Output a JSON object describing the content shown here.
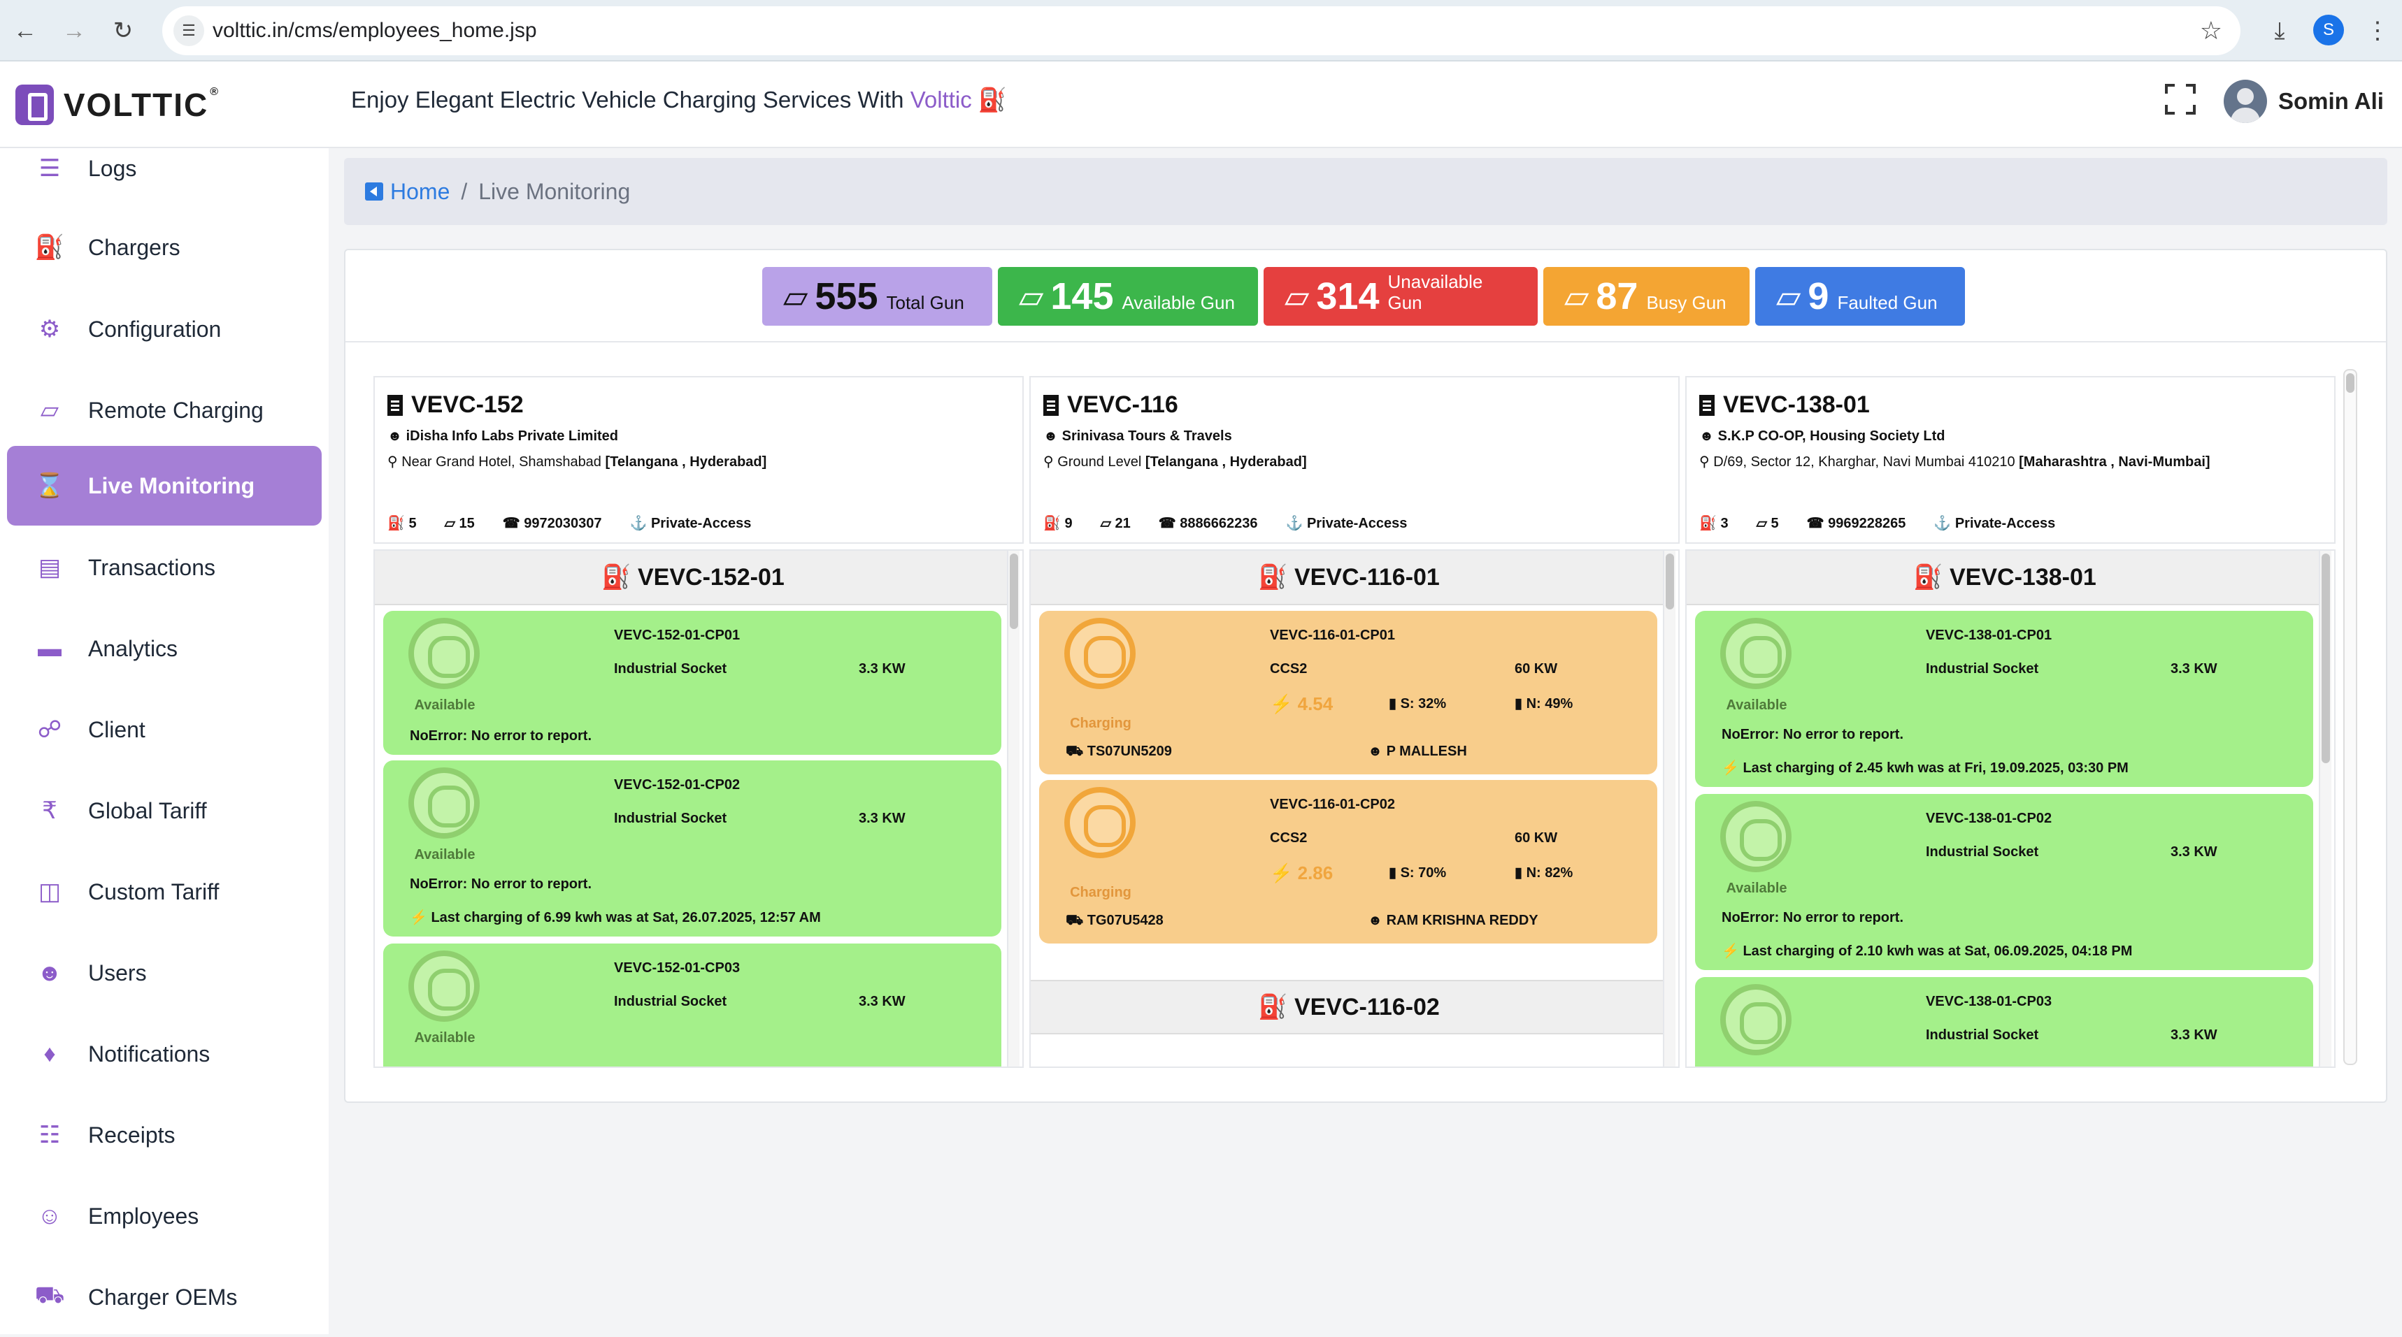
{
  "browser": {
    "url": "volttic.in/cms/employees_home.jsp",
    "profile_letter": "S"
  },
  "header": {
    "logo_text": "VOLTTIC",
    "tagline": "Enjoy Elegant Electric Vehicle Charging Services With ",
    "tagline_brand": "Volttic",
    "user_name": "Somin Ali"
  },
  "sidebar": {
    "items": [
      {
        "label": "Logs",
        "icon": "logs-icon"
      },
      {
        "label": "Chargers",
        "icon": "charger-icon"
      },
      {
        "label": "Configuration",
        "icon": "gears-icon"
      },
      {
        "label": "Remote Charging",
        "icon": "plug-icon"
      },
      {
        "label": "Live Monitoring",
        "icon": "hourglass-icon",
        "active": true
      },
      {
        "label": "Transactions",
        "icon": "card-icon"
      },
      {
        "label": "Analytics",
        "icon": "chart-icon"
      },
      {
        "label": "Client",
        "icon": "handshake-icon"
      },
      {
        "label": "Global Tariff",
        "icon": "rupee-icon"
      },
      {
        "label": "Custom Tariff",
        "icon": "charging-station-icon"
      },
      {
        "label": "Users",
        "icon": "users-icon"
      },
      {
        "label": "Notifications",
        "icon": "bell-icon"
      },
      {
        "label": "Receipts",
        "icon": "receipt-icon"
      },
      {
        "label": "Employees",
        "icon": "employees-icon"
      },
      {
        "label": "Charger OEMs",
        "icon": "truck-icon"
      }
    ]
  },
  "breadcrumb": {
    "home": "Home",
    "sep": "/",
    "current": "Live Monitoring"
  },
  "stats": [
    {
      "value": "555",
      "label": "Total Gun",
      "color": "#b9a2e8",
      "text_color": "#111111"
    },
    {
      "value": "145",
      "label": "Available Gun",
      "color": "#3cb64b",
      "text_color": "#ffffff"
    },
    {
      "value": "314",
      "label": "Unavailable Gun",
      "color": "#e5403f",
      "text_color": "#ffffff"
    },
    {
      "value": "87",
      "label": "Busy Gun",
      "color": "#f4a533",
      "text_color": "#ffffff"
    },
    {
      "value": "9",
      "label": "Faulted Gun",
      "color": "#3f7be3",
      "text_color": "#ffffff"
    }
  ],
  "stations": [
    {
      "id": "VEVC-152",
      "company": "iDisha Info Labs Private Limited",
      "address": "Near Grand Hotel, Shamshabad ",
      "region": "[Telangana , Hyderabad]",
      "chargers": "5",
      "guns": "15",
      "phone": "9972030307",
      "access": "Private-Access",
      "charger_block": "VEVC-152-01",
      "connectors": [
        {
          "id": "VEVC-152-01-CP01",
          "type": "Industrial Socket",
          "kw": "3.3 KW",
          "status": "Available",
          "error": "NoError: No error to report.",
          "last": ""
        },
        {
          "id": "VEVC-152-01-CP02",
          "type": "Industrial Socket",
          "kw": "3.3 KW",
          "status": "Available",
          "error": "NoError: No error to report.",
          "last": "Last charging of 6.99 kwh was at Sat, 26.07.2025, 12:57 AM"
        },
        {
          "id": "VEVC-152-01-CP03",
          "type": "Industrial Socket",
          "kw": "3.3 KW",
          "status": "Available",
          "error": "",
          "last": ""
        }
      ]
    },
    {
      "id": "VEVC-116",
      "company": "Srinivasa Tours & Travels",
      "address": "Ground Level ",
      "region": "[Telangana , Hyderabad]",
      "chargers": "9",
      "guns": "21",
      "phone": "8886662236",
      "access": "Private-Access",
      "charger_block": "VEVC-116-01",
      "charger_block_2": "VEVC-116-02",
      "connectors": [
        {
          "id": "VEVC-116-01-CP01",
          "type": "CCS2",
          "kw": "60 KW",
          "status": "Charging",
          "energy": "4.54",
          "soc": "S: 32%",
          "net": "N: 49%",
          "vehicle": "TS07UN5209",
          "driver": "P MALLESH"
        },
        {
          "id": "VEVC-116-01-CP02",
          "type": "CCS2",
          "kw": "60 KW",
          "status": "Charging",
          "energy": "2.86",
          "soc": "S: 70%",
          "net": "N: 82%",
          "vehicle": "TG07U5428",
          "driver": "RAM KRISHNA REDDY"
        }
      ]
    },
    {
      "id": "VEVC-138-01",
      "company": "S.K.P CO-OP, Housing Society Ltd",
      "address": "D/69, Sector 12, Kharghar, Navi Mumbai 410210 ",
      "region": "[Maharashtra , Navi-Mumbai]",
      "chargers": "3",
      "guns": "5",
      "phone": "9969228265",
      "access": "Private-Access",
      "charger_block": "VEVC-138-01",
      "connectors": [
        {
          "id": "VEVC-138-01-CP01",
          "type": "Industrial Socket",
          "kw": "3.3 KW",
          "status": "Available",
          "error": "NoError: No error to report.",
          "last": "Last charging of 2.45 kwh was at Fri, 19.09.2025, 03:30 PM"
        },
        {
          "id": "VEVC-138-01-CP02",
          "type": "Industrial Socket",
          "kw": "3.3 KW",
          "status": "Available",
          "error": "NoError: No error to report.",
          "last": "Last charging of 2.10 kwh was at Sat, 06.09.2025, 04:18 PM"
        },
        {
          "id": "VEVC-138-01-CP03",
          "type": "Industrial Socket",
          "kw": "3.3 KW",
          "status": "Available",
          "error": "",
          "last": ""
        }
      ]
    }
  ]
}
